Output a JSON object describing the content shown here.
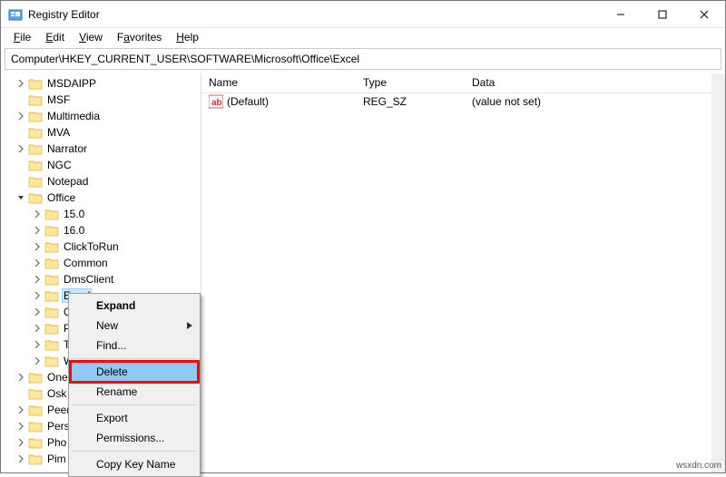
{
  "window": {
    "title": "Registry Editor"
  },
  "menu": {
    "file": "File",
    "edit": "Edit",
    "view": "View",
    "favorites": "Favorites",
    "help": "Help"
  },
  "address": "Computer\\HKEY_CURRENT_USER\\SOFTWARE\\Microsoft\\Office\\Excel",
  "tree": {
    "items": [
      {
        "label": "MSDAIPP",
        "indent": 1,
        "twisty": "right"
      },
      {
        "label": "MSF",
        "indent": 1,
        "twisty": "none"
      },
      {
        "label": "Multimedia",
        "indent": 1,
        "twisty": "right"
      },
      {
        "label": "MVA",
        "indent": 1,
        "twisty": "none"
      },
      {
        "label": "Narrator",
        "indent": 1,
        "twisty": "right"
      },
      {
        "label": "NGC",
        "indent": 1,
        "twisty": "none"
      },
      {
        "label": "Notepad",
        "indent": 1,
        "twisty": "none"
      },
      {
        "label": "Office",
        "indent": 1,
        "twisty": "down"
      },
      {
        "label": "15.0",
        "indent": 2,
        "twisty": "right"
      },
      {
        "label": "16.0",
        "indent": 2,
        "twisty": "right"
      },
      {
        "label": "ClickToRun",
        "indent": 2,
        "twisty": "right"
      },
      {
        "label": "Common",
        "indent": 2,
        "twisty": "right"
      },
      {
        "label": "DmsClient",
        "indent": 2,
        "twisty": "right"
      },
      {
        "label": "Excel",
        "indent": 2,
        "twisty": "right",
        "selected": true
      },
      {
        "label": "O",
        "indent": 2,
        "twisty": "right",
        "truncated": true
      },
      {
        "label": "P",
        "indent": 2,
        "twisty": "right",
        "truncated": true
      },
      {
        "label": "T",
        "indent": 2,
        "twisty": "right",
        "truncated": true
      },
      {
        "label": "W",
        "indent": 2,
        "twisty": "right",
        "truncated": true
      },
      {
        "label": "One",
        "indent": 1,
        "twisty": "right",
        "truncated": true
      },
      {
        "label": "Osk",
        "indent": 1,
        "twisty": "none",
        "truncated": true
      },
      {
        "label": "Peer",
        "indent": 1,
        "twisty": "right",
        "truncated": true
      },
      {
        "label": "Pers",
        "indent": 1,
        "twisty": "right",
        "truncated": true
      },
      {
        "label": "Pho",
        "indent": 1,
        "twisty": "right",
        "truncated": true
      },
      {
        "label": "Pim",
        "indent": 1,
        "twisty": "right",
        "truncated": true
      }
    ]
  },
  "list": {
    "cols": {
      "name": "Name",
      "type": "Type",
      "data": "Data"
    },
    "rows": [
      {
        "name": "(Default)",
        "type": "REG_SZ",
        "data": "(value not set)",
        "icon": "string"
      }
    ]
  },
  "context_menu": {
    "items": [
      {
        "label": "Expand",
        "bold": true
      },
      {
        "label": "New",
        "submenu": true
      },
      {
        "label": "Find..."
      },
      {
        "sep": true
      },
      {
        "label": "Delete",
        "highlight": true
      },
      {
        "label": "Rename"
      },
      {
        "sep": true
      },
      {
        "label": "Export"
      },
      {
        "label": "Permissions..."
      },
      {
        "sep": true
      },
      {
        "label": "Copy Key Name"
      }
    ]
  },
  "watermark": "wsxdn.com"
}
